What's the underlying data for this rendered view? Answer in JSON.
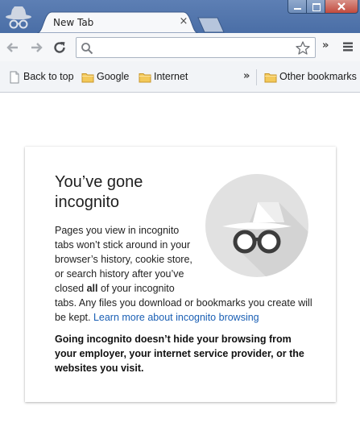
{
  "window": {
    "tab_title": "New Tab",
    "tab_close_glyph": "×",
    "incognito_icon": "incognito-spy-icon",
    "controls": [
      "minimize",
      "maximize",
      "close"
    ]
  },
  "toolbar": {
    "back_icon": "back-arrow-icon",
    "forward_icon": "forward-arrow-icon",
    "reload_icon": "reload-icon",
    "omnibox_value": "",
    "omnibox_placeholder": "",
    "extensions_chevron": "»",
    "menu_icon": "hamburger-menu-icon"
  },
  "bookmarks": {
    "items": [
      {
        "label": "Back to top",
        "icon": "page-icon"
      },
      {
        "label": "Google",
        "icon": "folder-icon"
      },
      {
        "label": "Internet",
        "icon": "folder-icon"
      }
    ],
    "overflow_chevron": "»",
    "other": {
      "label": "Other bookmarks",
      "icon": "folder-icon"
    }
  },
  "content": {
    "headline": "You’ve gone incognito",
    "body_part1": "Pages you view in incognito tabs won’t stick around in your browser’s history, cookie store, or search history after you’ve closed ",
    "body_bold": "all",
    "body_part2": " of your incognito tabs. Any files you download or bookmarks you create will be kept. ",
    "learn_more": "Learn more about incognito browsing",
    "warning": "Going incognito doesn’t hide your browsing from your employer, your internet service provider, or the websites you visit."
  },
  "colors": {
    "title_bar": "#5073aa",
    "link": "#1a5fb4",
    "folder": "#f0c040",
    "illustration_circle": "#e0e0e0"
  }
}
